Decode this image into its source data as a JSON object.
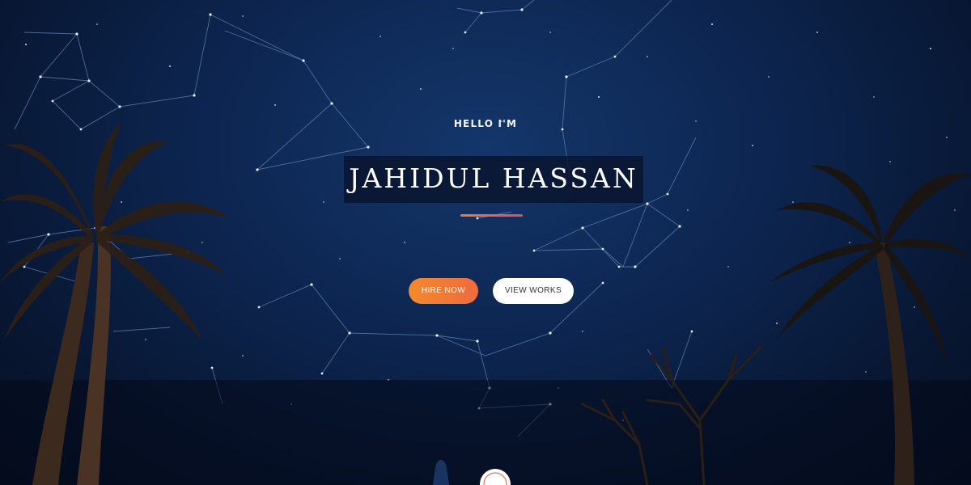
{
  "hero": {
    "greeting": "HELLO I'M",
    "name": "JAHIDUL HASSAN"
  },
  "buttons": {
    "hire": "HIRE NOW",
    "works": "VIEW WORKS"
  },
  "icons": {
    "scroll": "scroll-down-icon"
  },
  "colors": {
    "background": "#0b1d3d",
    "accent_start": "#f28a2c",
    "accent_end": "#f06a3e",
    "underline": "#e0534b",
    "constellation": "#5f86b5"
  }
}
